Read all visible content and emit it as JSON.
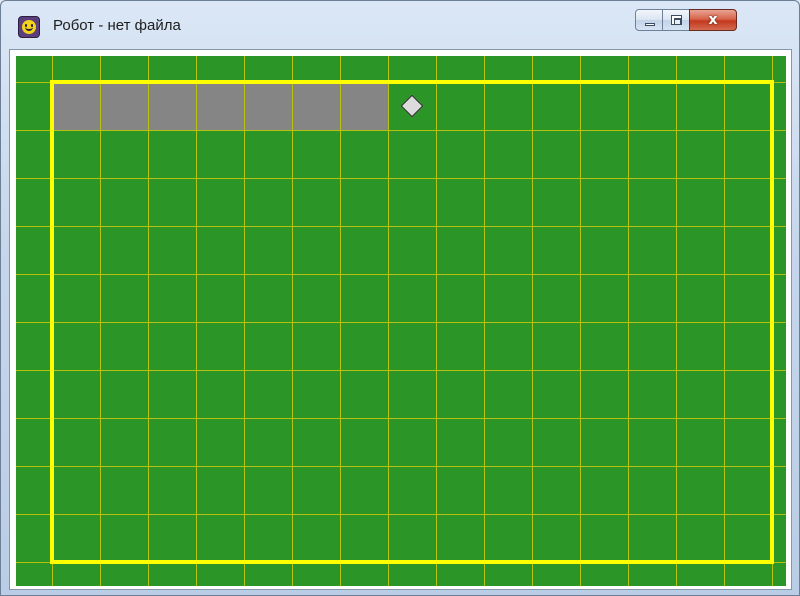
{
  "window": {
    "title": "Робот - нет файла",
    "icon": "robot-smiley-icon"
  },
  "controls": {
    "minimize_icon": "minimize-icon",
    "maximize_icon": "maximize-icon",
    "close_icon": "close-icon",
    "close_glyph": "x"
  },
  "field": {
    "colors": {
      "background": "#2b9627",
      "grid_line": "#b8c20e",
      "wall": "#ffff00",
      "painted_cell": "#858585",
      "robot": "#dcdcdc"
    },
    "painted_cells": 7,
    "robot_icon": "robot-diamond-icon"
  }
}
